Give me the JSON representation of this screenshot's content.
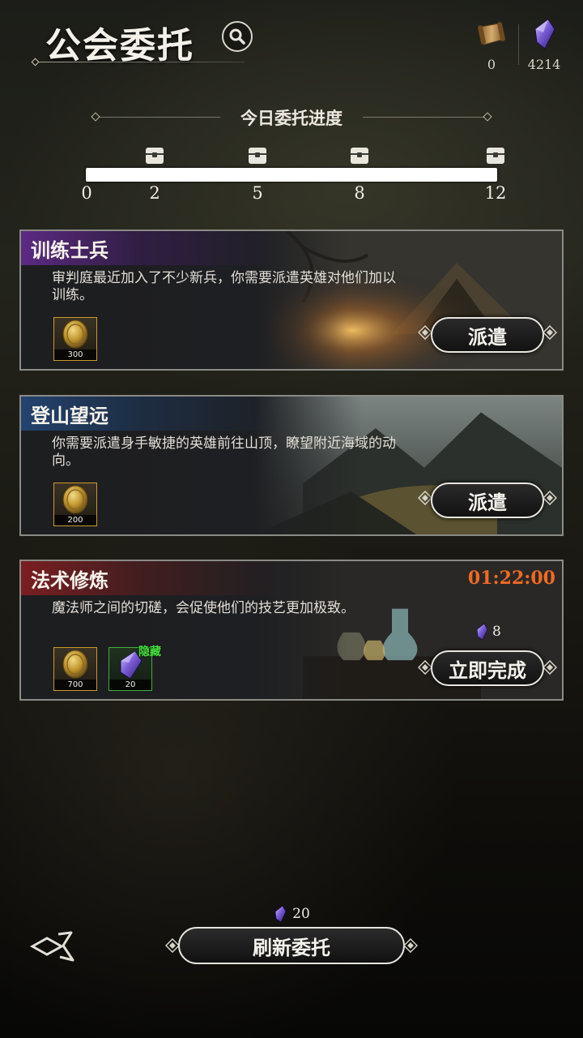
{
  "header": {
    "title": "公会委托",
    "resources": [
      {
        "icon": "scroll-icon",
        "value": "0"
      },
      {
        "icon": "crystal-icon",
        "value": "4214"
      }
    ]
  },
  "progress": {
    "label": "今日委托进度",
    "current": 12,
    "max": 12,
    "ticks": [
      "0",
      "2",
      "5",
      "8",
      "12"
    ],
    "chest_icons": [
      "chest-icon",
      "chest-icon",
      "chest-icon",
      "chest-icon"
    ]
  },
  "commissions": [
    {
      "title": "训练士兵",
      "description": "审判庭最近加入了不少新兵，你需要派遣英雄对他们加以训练。",
      "rewards": [
        {
          "icon": "gold-coin-icon",
          "count": "300"
        }
      ],
      "button": "派遣"
    },
    {
      "title": "登山望远",
      "description": "你需要派遣身手敏捷的英雄前往山顶，瞭望附近海域的动向。",
      "rewards": [
        {
          "icon": "gold-coin-icon",
          "count": "200"
        }
      ],
      "button": "派遣"
    },
    {
      "title": "法术修炼",
      "description": "魔法师之间的切磋，会促使他们的技艺更加极致。",
      "timer": "01:22:00",
      "rewards": [
        {
          "icon": "gold-coin-icon",
          "count": "700"
        },
        {
          "icon": "crystal-icon",
          "count": "20",
          "tag": "隐藏"
        }
      ],
      "cost": "8",
      "button": "立即完成"
    }
  ],
  "footer": {
    "refresh_cost": "20",
    "refresh_label": "刷新委托"
  },
  "colors": {
    "timer": "#ef6a23",
    "hidden_tag": "#43e03a",
    "reward_border_gold": "#c99a2a",
    "reward_border_green": "#3fae3c"
  }
}
